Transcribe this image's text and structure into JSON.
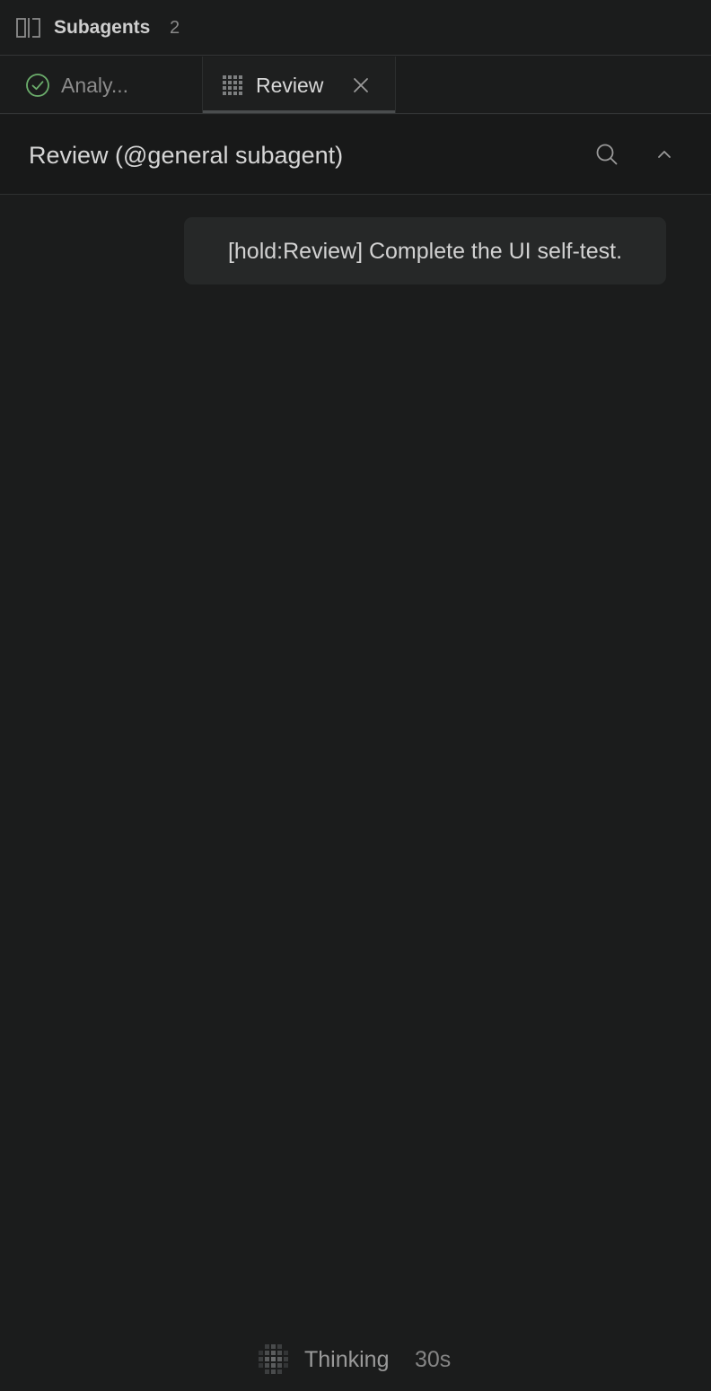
{
  "header": {
    "title": "Subagents",
    "count": "2",
    "toggle_icon": "panel-split-icon"
  },
  "tabs": [
    {
      "label": "Analy...",
      "status_icon": "check-circle-icon",
      "status_color": "#6cae6c",
      "active": false
    },
    {
      "label": "Review",
      "status_icon": "loading-grid-icon",
      "active": true,
      "close_icon": "close-icon"
    }
  ],
  "panel": {
    "title": "Review (@general subagent)",
    "search_icon": "search-icon",
    "collapse_icon": "chevron-up-icon"
  },
  "messages": [
    {
      "role": "user",
      "text": "[hold:Review] Complete the UI self-test."
    }
  ],
  "status": {
    "label": "Thinking",
    "elapsed": "30s",
    "icon": "loading-grid-icon"
  },
  "colors": {
    "background": "#1b1c1c",
    "bubble": "#262828",
    "success": "#6cae6c"
  }
}
